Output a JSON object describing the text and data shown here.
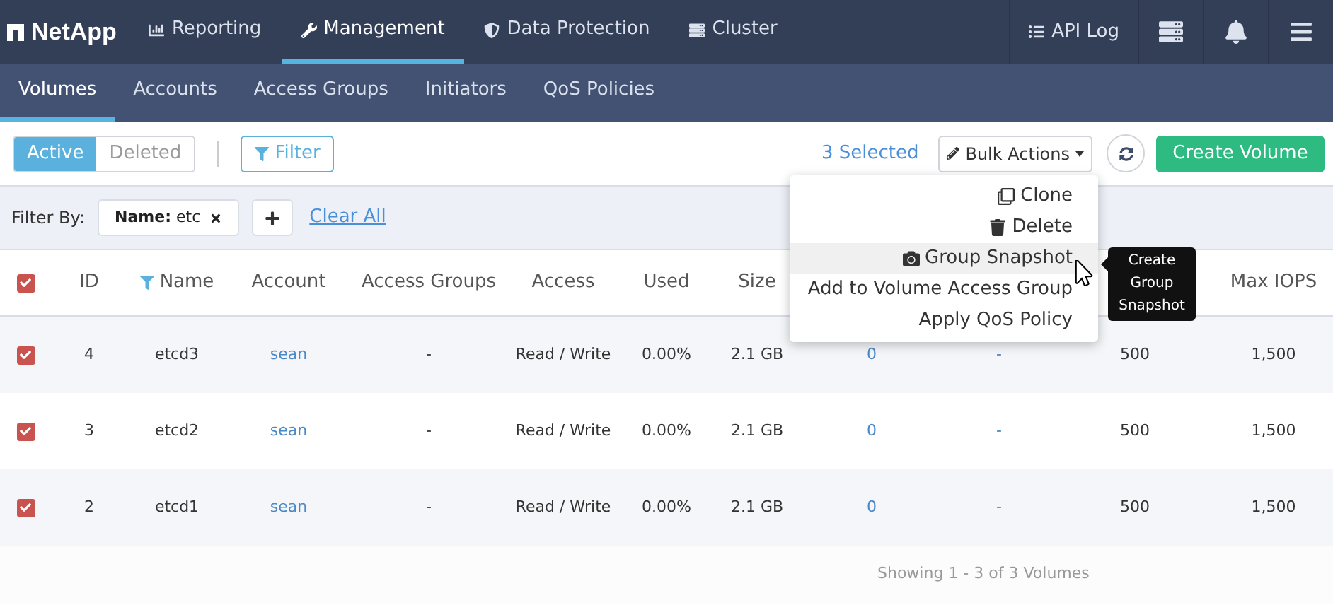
{
  "brand": "NetApp",
  "nav": [
    {
      "label": "Reporting",
      "selected": false
    },
    {
      "label": "Management",
      "selected": true
    },
    {
      "label": "Data Protection",
      "selected": false
    },
    {
      "label": "Cluster",
      "selected": false
    }
  ],
  "api_log": "API Log",
  "subnav": [
    {
      "label": "Volumes",
      "selected": true
    },
    {
      "label": "Accounts",
      "selected": false
    },
    {
      "label": "Access Groups",
      "selected": false
    },
    {
      "label": "Initiators",
      "selected": false
    },
    {
      "label": "QoS Policies",
      "selected": false
    }
  ],
  "toggle": [
    {
      "label": "Active",
      "selected": true
    },
    {
      "label": "Deleted",
      "selected": false
    }
  ],
  "filter_button": "Filter",
  "selected_count": "3 Selected",
  "bulk_actions": "Bulk Actions",
  "create_button": "Create Volume",
  "filter_bar": {
    "label": "Filter By:",
    "chips": [
      {
        "key": "Name:",
        "value": "etc"
      }
    ],
    "clear": "Clear All"
  },
  "bulk_menu": [
    {
      "label": "Clone",
      "selected": false
    },
    {
      "label": "Delete",
      "selected": false
    },
    {
      "label": "Group Snapshot",
      "selected": true
    },
    {
      "label": "Add to Volume Access Group",
      "selected": false
    },
    {
      "label": "Apply QoS Policy",
      "selected": false
    }
  ],
  "tooltip": "Create Group Snapshot",
  "table": {
    "header_checked": true,
    "columns": [
      {
        "label": "ID",
        "filter": false
      },
      {
        "label": "Name",
        "filter": true
      },
      {
        "label": "Account",
        "filter": false
      },
      {
        "label": "Access Groups",
        "filter": false
      },
      {
        "label": "Access",
        "filter": false
      },
      {
        "label": "Used",
        "filter": false
      },
      {
        "label": "Size",
        "filter": false
      },
      null,
      null,
      null,
      {
        "label": "Max IOPS",
        "filter": false
      }
    ],
    "rows": [
      {
        "checked": true,
        "cells": [
          "4",
          "etcd3",
          "sean",
          "-",
          "Read / Write",
          "0.00%",
          "2.1 GB",
          "0",
          "-",
          "500",
          "1,500"
        ]
      },
      {
        "checked": true,
        "cells": [
          "3",
          "etcd2",
          "sean",
          "-",
          "Read / Write",
          "0.00%",
          "2.1 GB",
          "0",
          "-",
          "500",
          "1,500"
        ]
      },
      {
        "checked": true,
        "cells": [
          "2",
          "etcd1",
          "sean",
          "-",
          "Read / Write",
          "0.00%",
          "2.1 GB",
          "0",
          "-",
          "500",
          "1,500"
        ]
      }
    ]
  },
  "footer": "Showing 1 - 3 of 3 Volumes"
}
